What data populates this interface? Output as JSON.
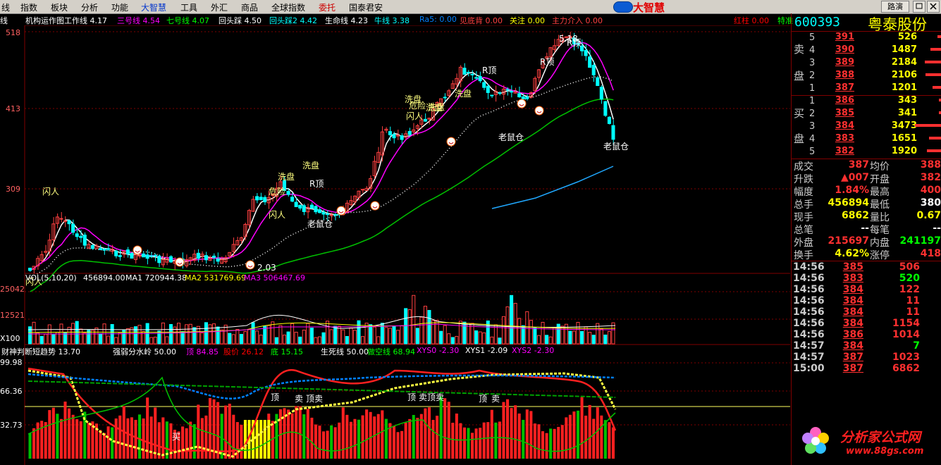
{
  "menu": [
    "线",
    "指数",
    "板块",
    "分析",
    "功能",
    "大智慧",
    "工具",
    "外汇",
    "商品",
    "全球指数",
    "委托",
    "国泰君安"
  ],
  "brand": {
    "text": "大智慧"
  },
  "window_buttons": {
    "luyan": "路演"
  },
  "indicator_line": [
    {
      "text": "线",
      "color": "#ffffff"
    },
    {
      "text": "机构运作图工作线 4.17",
      "color": "#ffffff"
    },
    {
      "text": "三号线 4.54",
      "color": "#ff00ff"
    },
    {
      "text": "七号线 4.07",
      "color": "#00ff00"
    },
    {
      "text": "回头踩 4.50",
      "color": "#ffffff"
    },
    {
      "text": "回头踩2 4.42",
      "color": "#00ffff"
    },
    {
      "text": "生命线 4.23",
      "color": "#ffffff"
    },
    {
      "text": "牛线 3.38",
      "color": "#00ffff"
    },
    {
      "text": "Ra5: 0.00",
      "color": "#0080ff"
    },
    {
      "text": "见底背 0.00",
      "color": "#ff4040"
    },
    {
      "text": "关注 0.00",
      "color": "#ffff00"
    },
    {
      "text": "主力介入 0.00",
      "color": "#ff4040"
    },
    {
      "text": "红柱 0.00",
      "color": "#ff0000"
    },
    {
      "text": "特准",
      "color": "#00ff00"
    }
  ],
  "price_axis": [
    "518",
    "413",
    "309"
  ],
  "vol_axis": [
    "25042",
    "12521",
    "X100"
  ],
  "osc_axis": [
    "99.98",
    "66.36",
    "32.73"
  ],
  "vol_title": [
    {
      "text": "VOL(5,10,20)",
      "color": "#ffffff"
    },
    {
      "text": "456894.00",
      "color": "#ffffff"
    },
    {
      "text": "MA1 720944.38",
      "color": "#ffffff"
    },
    {
      "text": "MA2 531769.69",
      "color": "#ffff00"
    },
    {
      "text": "MA3 506467.69",
      "color": "#ff00ff"
    }
  ],
  "osc_title": [
    {
      "text": "财神判断短趋势 13.70",
      "color": "#ffffff"
    },
    {
      "text": "强弱分水岭 50.00",
      "color": "#ffffff"
    },
    {
      "text": "顶 84.85",
      "color": "#ff00ff"
    },
    {
      "text": "股价 26.12",
      "color": "#ff0000"
    },
    {
      "text": "底 15.15",
      "color": "#00ff00"
    },
    {
      "text": "生死线 50.00",
      "color": "#ffffff"
    },
    {
      "text": "做空线 68.94",
      "color": "#00ff00"
    },
    {
      "text": "XYS0 -2.30",
      "color": "#ff00ff"
    },
    {
      "text": "XYS1 -2.09",
      "color": "#ffffff"
    },
    {
      "text": "XYS2 -2.30",
      "color": "#ff00ff"
    }
  ],
  "price_annotations": [
    {
      "text": "闪人",
      "color": "#ffff80"
    },
    {
      "text": "闪人",
      "color": "#ffff80"
    },
    {
      "text": "洗盘",
      "color": "#ffff80"
    },
    {
      "text": "危险",
      "color": "#ffff80"
    },
    {
      "text": "洗盘",
      "color": "#ffff80"
    },
    {
      "text": "R顶",
      "color": "#ffffff"
    },
    {
      "text": "闪人",
      "color": "#ffff80"
    },
    {
      "text": "老鼠仓",
      "color": "#ffffff"
    },
    {
      "text": "洗盘",
      "color": "#ffff80"
    },
    {
      "text": "危险",
      "color": "#ffff80"
    },
    {
      "text": "洗盘",
      "color": "#ffff80"
    },
    {
      "text": "闪人",
      "color": "#ffff80"
    },
    {
      "text": "洗盘",
      "color": "#ffff80"
    },
    {
      "text": "洗盘",
      "color": "#ffff80"
    },
    {
      "text": "R顶",
      "color": "#ffffff"
    },
    {
      "text": "老鼠仓",
      "color": "#ffffff"
    },
    {
      "text": "R顶",
      "color": "#ffffff"
    },
    {
      "text": "5.18",
      "color": "#ffffff"
    },
    {
      "text": "R顶",
      "color": "#ffffff"
    },
    {
      "text": "老鼠仓",
      "color": "#ffffff"
    },
    {
      "text": "2.03",
      "color": "#ffffff"
    }
  ],
  "osc_annotations": [
    {
      "text": "买",
      "color": "#ffffff"
    },
    {
      "text": "顶",
      "color": "#ffffff"
    },
    {
      "text": "卖",
      "color": "#ffffff"
    },
    {
      "text": "顶卖",
      "color": "#ffffff"
    },
    {
      "text": "顶",
      "color": "#ffffff"
    },
    {
      "text": "卖顶卖",
      "color": "#ffffff"
    },
    {
      "text": "顶",
      "color": "#ffffff"
    },
    {
      "text": "卖",
      "color": "#ffffff"
    }
  ],
  "stock": {
    "code": "600393",
    "name": "粤泰股份"
  },
  "orderbook": {
    "sell_label": [
      "卖",
      "盘"
    ],
    "buy_label": [
      "买",
      "盘"
    ],
    "sell": [
      {
        "idx": "5",
        "price": "391",
        "vol": "526",
        "bar": 0.15
      },
      {
        "idx": "4",
        "price": "390",
        "vol": "1487",
        "bar": 0.43
      },
      {
        "idx": "3",
        "price": "389",
        "vol": "2184",
        "bar": 0.63
      },
      {
        "idx": "2",
        "price": "388",
        "vol": "2106",
        "bar": 0.61
      },
      {
        "idx": "1",
        "price": "387",
        "vol": "1201",
        "bar": 0.35
      }
    ],
    "buy": [
      {
        "idx": "1",
        "price": "386",
        "vol": "343",
        "bar": 0.1
      },
      {
        "idx": "2",
        "price": "385",
        "vol": "341",
        "bar": 0.1
      },
      {
        "idx": "3",
        "price": "384",
        "vol": "3473",
        "bar": 1.0
      },
      {
        "idx": "4",
        "price": "383",
        "vol": "1651",
        "bar": 0.48
      },
      {
        "idx": "5",
        "price": "382",
        "vol": "1920",
        "bar": 0.55
      }
    ]
  },
  "quote": [
    {
      "l1": "成交",
      "v1": "387",
      "c1": "#ff3030",
      "l2": "均价",
      "v2": "388",
      "c2": "#ff3030"
    },
    {
      "l1": "升跌",
      "v1": "▲007",
      "c1": "#ff3030",
      "l2": "开盘",
      "v2": "382",
      "c2": "#ff3030"
    },
    {
      "l1": "幅度",
      "v1": "1.84%",
      "c1": "#ff3030",
      "l2": "最高",
      "v2": "400",
      "c2": "#ff3030"
    },
    {
      "l1": "总手",
      "v1": "456894",
      "c1": "#ffff00",
      "l2": "最低",
      "v2": "380",
      "c2": "#ffffff"
    },
    {
      "l1": "现手",
      "v1": "6862",
      "c1": "#ffff00",
      "l2": "量比",
      "v2": "0.67",
      "c2": "#ffff00"
    },
    {
      "l1": "总笔",
      "v1": "--",
      "c1": "#ffffff",
      "l2": "每笔",
      "v2": "--",
      "c2": "#ffffff"
    },
    {
      "l1": "外盘",
      "v1": "215697",
      "c1": "#ff3030",
      "l2": "内盘",
      "v2": "241197",
      "c2": "#00ff00"
    },
    {
      "l1": "换手",
      "v1": "4.62%",
      "c1": "#ffff00",
      "l2": "涨停",
      "v2": "418",
      "c2": "#ff3030"
    }
  ],
  "ticks": [
    {
      "time": "14:56",
      "price": "385",
      "pc": "#ff3030",
      "vol": "506",
      "vc": "#ff3030"
    },
    {
      "time": "14:56",
      "price": "383",
      "pc": "#ff3030",
      "vol": "520",
      "vc": "#00ff00"
    },
    {
      "time": "14:56",
      "price": "384",
      "pc": "#ff3030",
      "vol": "122",
      "vc": "#ff3030"
    },
    {
      "time": "14:56",
      "price": "384",
      "pc": "#ff3030",
      "vol": "11",
      "vc": "#ff3030"
    },
    {
      "time": "14:56",
      "price": "384",
      "pc": "#ff3030",
      "vol": "11",
      "vc": "#ff3030"
    },
    {
      "time": "14:56",
      "price": "384",
      "pc": "#ff3030",
      "vol": "1154",
      "vc": "#ff3030"
    },
    {
      "time": "14:56",
      "price": "386",
      "pc": "#ff3030",
      "vol": "1014",
      "vc": "#ff3030"
    },
    {
      "time": "14:57",
      "price": "384",
      "pc": "#ff3030",
      "vol": "7",
      "vc": "#00ff00"
    },
    {
      "time": "14:57",
      "price": "387",
      "pc": "#ff3030",
      "vol": "1023",
      "vc": "#ff3030"
    },
    {
      "time": "15:00",
      "price": "387",
      "pc": "#ff3030",
      "vol": "6862",
      "vc": "#ff3030"
    }
  ],
  "watermark": {
    "line1": "分析家公式网",
    "line2": "www.88gs.com"
  }
}
